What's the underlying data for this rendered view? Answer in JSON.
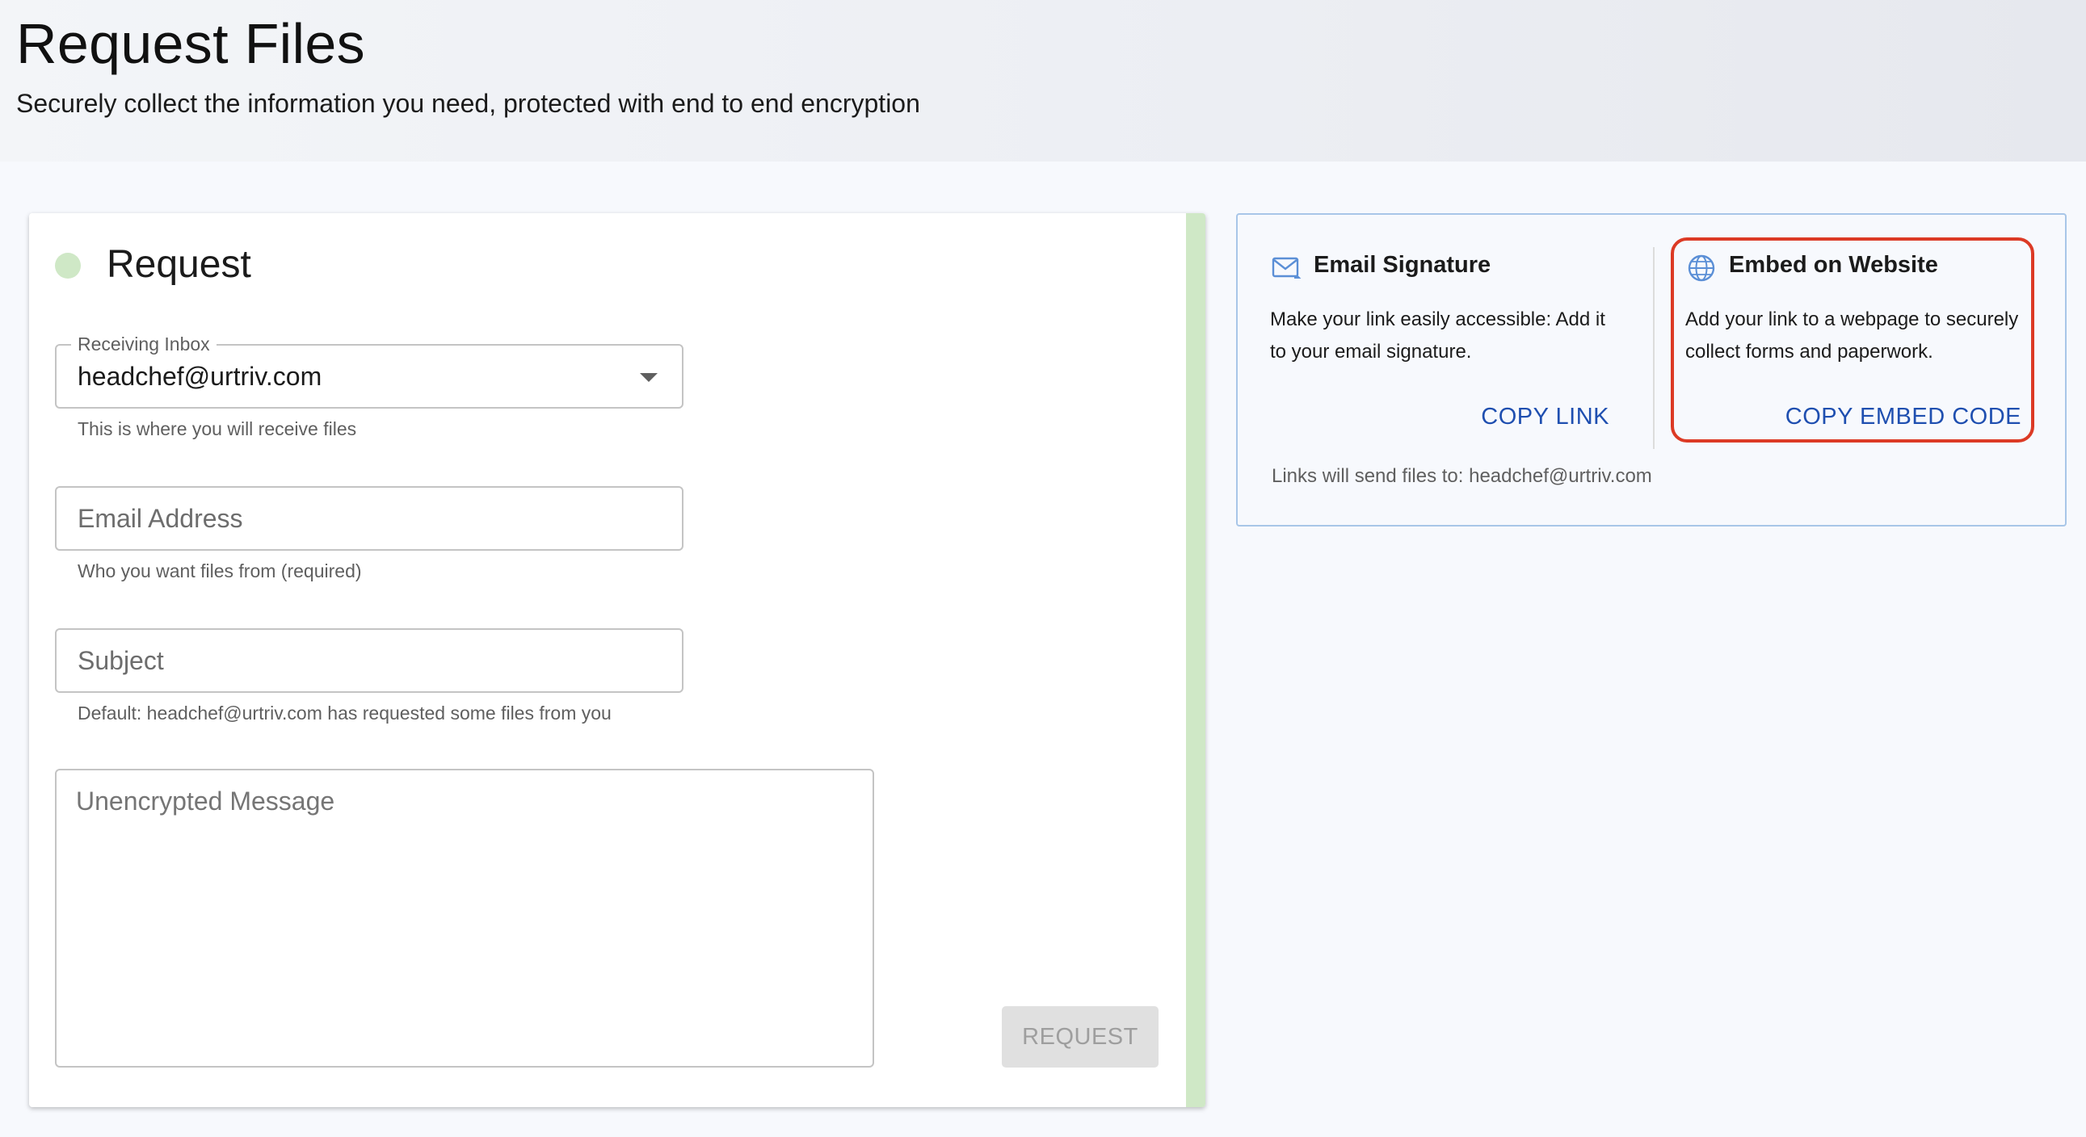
{
  "header": {
    "title": "Request Files",
    "subtitle": "Securely collect the information you need, protected with end to end encryption"
  },
  "request_form": {
    "title": "Request",
    "receiving_inbox": {
      "label": "Receiving Inbox",
      "value": "headchef@urtriv.com",
      "helper": "This is where you will receive files"
    },
    "email": {
      "placeholder": "Email Address",
      "helper": "Who you want files from (required)"
    },
    "subject": {
      "placeholder": "Subject",
      "helper": "Default: headchef@urtriv.com has requested some files from you"
    },
    "message": {
      "placeholder": "Unencrypted Message"
    },
    "submit_label": "REQUEST",
    "colors": {
      "accent": "#cfe8c6"
    }
  },
  "share": {
    "email_signature": {
      "icon": "mail-icon",
      "title": "Email Signature",
      "description": "Make your link easily accessible: Add it to your email signature.",
      "action": "COPY LINK"
    },
    "embed": {
      "icon": "globe-icon",
      "title": "Embed on Website",
      "description": "Add your link to a webpage to securely collect forms and paperwork.",
      "action": "COPY EMBED CODE"
    },
    "footnote": "Links will send files to: headchef@urtriv.com",
    "colors": {
      "link": "#1f4fb0",
      "border": "#a8c6e8",
      "highlight": "#dc3a25"
    }
  }
}
